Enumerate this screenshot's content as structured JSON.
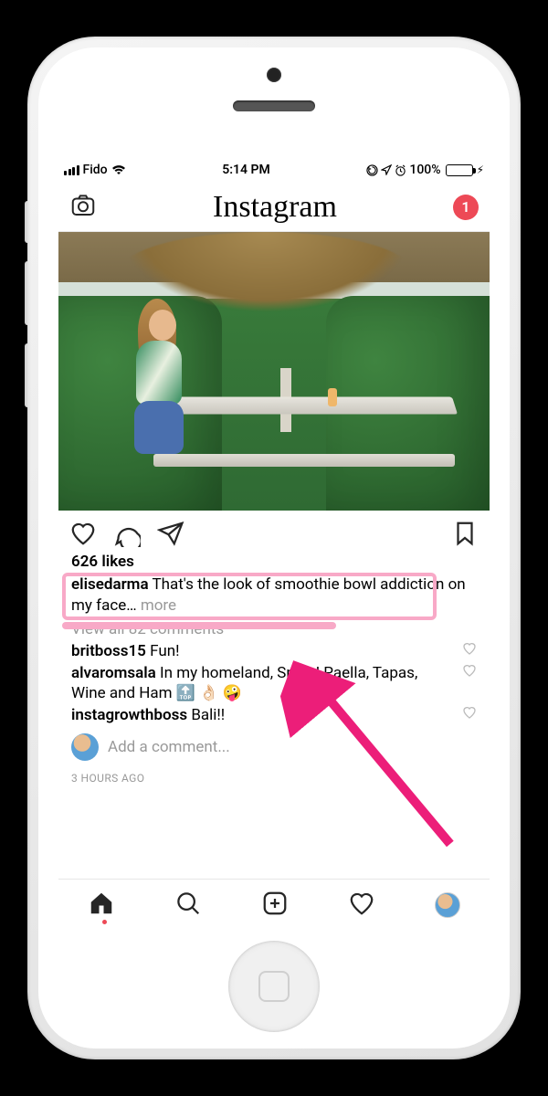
{
  "statusbar": {
    "carrier": "Fido",
    "time": "5:14 PM",
    "battery_pct": "100%"
  },
  "header": {
    "logo_text": "Instagram",
    "badge_count": "1"
  },
  "post": {
    "likes_text": "626 likes",
    "caption_user": "elisedarma",
    "caption_text": "That's the look of smoothie bowl addiction on my face… ",
    "more_label": "more",
    "view_all": "View all 82 comments",
    "comments": [
      {
        "user": "britboss15",
        "text": "Fun!"
      },
      {
        "user": "alvaromsala",
        "text": "In my homeland, Spain! Paella, Tapas, Wine and Ham 🔝 👌🏻 🤪"
      },
      {
        "user": "instagrowthboss",
        "text": "Bali!!"
      }
    ],
    "add_comment_placeholder": "Add a comment...",
    "timestamp": "3 HOURS AGO"
  }
}
